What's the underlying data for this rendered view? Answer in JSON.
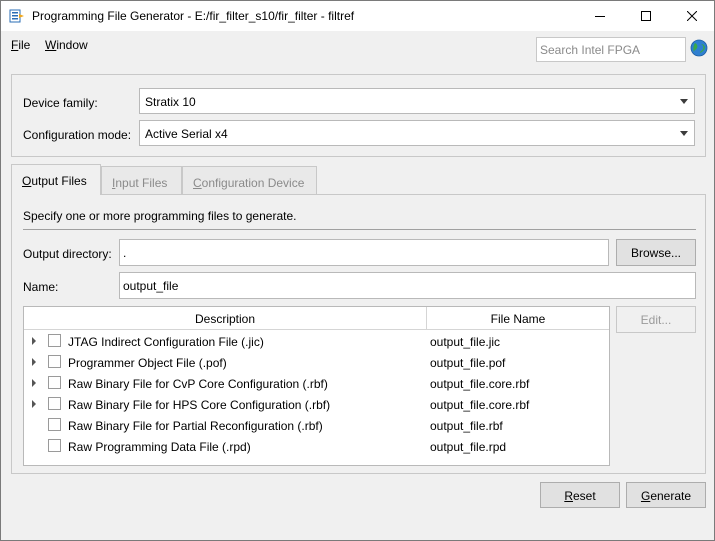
{
  "titlebar": {
    "title": "Programming File Generator - E:/fir_filter_s10/fir_filter - filtref"
  },
  "menu": {
    "file": {
      "accel": "F",
      "rest": "ile"
    },
    "window": {
      "accel": "W",
      "rest": "indow"
    }
  },
  "search": {
    "placeholder": "Search Intel FPGA"
  },
  "device": {
    "family_label": "Device family:",
    "family_value": "Stratix 10",
    "config_mode_label": "Configuration mode:",
    "config_mode_value": "Active Serial x4"
  },
  "tabs": [
    {
      "accel": "O",
      "rest": "utput Files",
      "active": true
    },
    {
      "accel": "I",
      "rest": "nput Files",
      "active": false
    },
    {
      "accel": "C",
      "rest": "onfiguration Device",
      "active": false
    }
  ],
  "output": {
    "description": "Specify one or more programming files to generate.",
    "dir_label": "Output directory:",
    "dir_value": ".",
    "browse_label": "Browse...",
    "name_label": "Name:",
    "name_value": "output_file",
    "edit_label": "Edit..."
  },
  "table": {
    "col_description": "Description",
    "col_filename": "File Name",
    "rows": [
      {
        "description": "JTAG Indirect Configuration File (.jic)",
        "filename": "output_file.jic",
        "expandable": true,
        "checked": false
      },
      {
        "description": "Programmer Object File (.pof)",
        "filename": "output_file.pof",
        "expandable": true,
        "checked": false
      },
      {
        "description": "Raw Binary File for CvP Core Configuration (.rbf)",
        "filename": "output_file.core.rbf",
        "expandable": true,
        "checked": false
      },
      {
        "description": "Raw Binary File for HPS Core Configuration (.rbf)",
        "filename": "output_file.core.rbf",
        "expandable": true,
        "checked": false
      },
      {
        "description": "Raw Binary File for Partial Reconfiguration (.rbf)",
        "filename": "output_file.rbf",
        "expandable": false,
        "checked": false
      },
      {
        "description": "Raw Programming Data File (.rpd)",
        "filename": "output_file.rpd",
        "expandable": false,
        "checked": false
      }
    ]
  },
  "footer": {
    "reset": {
      "accel": "R",
      "rest": "eset"
    },
    "generate": {
      "accel": "G",
      "rest": "enerate"
    }
  }
}
